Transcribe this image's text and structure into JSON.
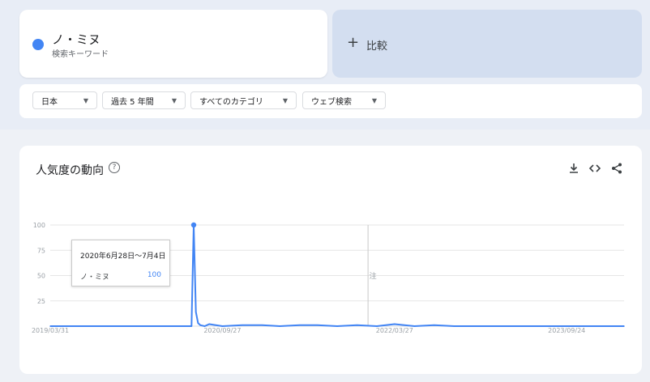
{
  "term": {
    "name": "ノ・ミヌ",
    "subtitle": "検索キーワード",
    "color": "#4285f4"
  },
  "compare": {
    "plus": "+",
    "label": "比較"
  },
  "filters": [
    {
      "label": "日本"
    },
    {
      "label": "過去 5 年間"
    },
    {
      "label": "すべてのカテゴリ"
    },
    {
      "label": "ウェブ検索"
    }
  ],
  "chart_section": {
    "title": "人気度の動向",
    "help": "?",
    "icons": [
      "download-icon",
      "embed-icon",
      "share-icon"
    ]
  },
  "tooltip": {
    "date": "2020年6月28日〜7月4日",
    "term": "ノ・ミヌ",
    "value": "100"
  },
  "chart_data": {
    "type": "line",
    "title": "",
    "xlabel": "",
    "ylabel": "",
    "ylim": [
      0,
      100
    ],
    "yticks": [
      25,
      50,
      75,
      100
    ],
    "xtick_labels": [
      "2019/03/31",
      "2020/09/27",
      "2022/03/27",
      "2023/09/24"
    ],
    "annotation": "注",
    "grid": true,
    "series": [
      {
        "name": "ノ・ミヌ",
        "color": "#4285f4",
        "x": [
          "2019/03/31",
          "2019/06/30",
          "2019/09/29",
          "2019/12/29",
          "2020/03/29",
          "2020/05/31",
          "2020/06/21",
          "2020/06/28",
          "2020/07/05",
          "2020/07/12",
          "2020/07/19",
          "2020/08/02",
          "2020/08/16",
          "2020/09/27",
          "2020/11/29",
          "2021/01/31",
          "2021/03/28",
          "2021/05/30",
          "2021/07/25",
          "2021/09/26",
          "2021/11/28",
          "2022/01/30",
          "2022/03/27",
          "2022/05/29",
          "2022/07/31",
          "2022/10/02",
          "2022/12/25",
          "2023/03/26",
          "2023/06/25",
          "2023/09/24",
          "2023/12/24",
          "2024/03/24"
        ],
        "y": [
          0,
          0,
          0,
          0,
          0,
          0,
          0,
          100,
          14,
          3,
          1,
          0,
          2,
          0,
          1,
          1,
          0,
          1,
          1,
          0,
          1,
          0,
          2,
          0,
          1,
          0,
          0,
          0,
          0,
          0,
          0,
          0
        ]
      }
    ]
  }
}
